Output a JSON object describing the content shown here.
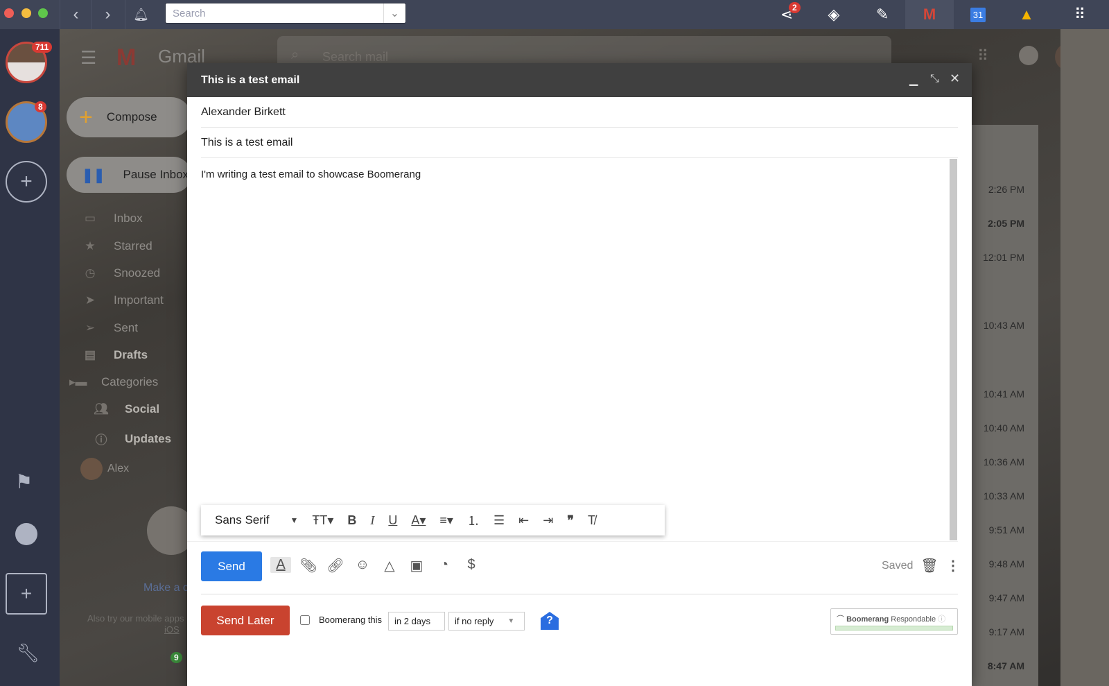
{
  "browser": {
    "search_placeholder": "Search",
    "share_badge": "2",
    "calendar_day": "31"
  },
  "dock": {
    "account1_badge": "711",
    "account2_badge": "8"
  },
  "gmail": {
    "logo_text": "Gmail",
    "search_placeholder": "Search mail",
    "compose_label": "Compose",
    "pause_label": "Pause Inbox",
    "nav": [
      {
        "label": "Inbox",
        "icon": "inbox-icon"
      },
      {
        "label": "Starred",
        "icon": "star-icon"
      },
      {
        "label": "Snoozed",
        "icon": "clock-icon"
      },
      {
        "label": "Important",
        "icon": "important-icon"
      },
      {
        "label": "Sent",
        "icon": "send-icon"
      },
      {
        "label": "Drafts",
        "icon": "draft-icon"
      },
      {
        "label": "Categories",
        "icon": "label-icon"
      },
      {
        "label": "Social",
        "icon": "people-icon"
      },
      {
        "label": "Updates",
        "icon": "info-icon"
      }
    ],
    "hangouts_user": "Alex",
    "hangouts_call": "Make a c",
    "mobile_apps": "Also try our mobile apps",
    "ios_link": "iOS",
    "chat_badge": "9",
    "times": [
      "2:26 PM",
      "2:05 PM",
      "12:01 PM",
      "10:43 AM",
      "10:41 AM",
      "10:40 AM",
      "10:36 AM",
      "10:33 AM",
      "9:51 AM",
      "9:48 AM",
      "9:47 AM",
      "9:17 AM",
      "8:47 AM"
    ]
  },
  "compose": {
    "title": "This is a test email",
    "to": "Alexander Birkett",
    "subject": "This is a test email",
    "body": "I'm writing a test email to showcase Boomerang",
    "font": "Sans Serif",
    "send_label": "Send",
    "saved_label": "Saved",
    "send_later_label": "Send Later",
    "boomerang_label": "Boomerang this",
    "boomerang_checked": false,
    "when": "in 2 days",
    "condition": "if no reply",
    "respondable_brand": "Boomerang",
    "respondable_label": "Respondable"
  }
}
